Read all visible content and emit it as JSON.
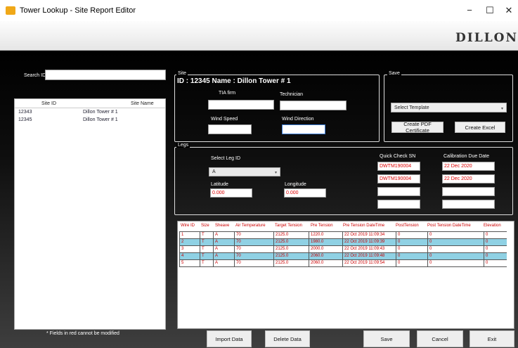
{
  "window": {
    "title": "Tower Lookup - Site Report Editor",
    "minimize": "−",
    "maximize": "☐",
    "close": "✕"
  },
  "logo": "DILLON",
  "search": {
    "label": "Search ID",
    "value": ""
  },
  "site_list": {
    "headers": [
      "Site ID",
      "Site Name"
    ],
    "rows": [
      [
        "12343",
        "Dillon Tower # 1"
      ],
      [
        "12345",
        "Dillon Tower # 1"
      ]
    ]
  },
  "footnote": "* Fields in red cannot be modified",
  "site_group": {
    "title": "Site",
    "heading": "ID : 12345 Name : Dillon Tower # 1",
    "tia_label": "TIA firm",
    "tia_value": "",
    "tech_label": "Technician",
    "tech_value": "",
    "wind_speed_label": "Wind Speed",
    "wind_speed_value": "",
    "wind_dir_label": "Wind Direction",
    "wind_dir_value": ""
  },
  "save_group": {
    "title": "Save",
    "template_value": "Select Template",
    "pdf_button": "Create PDF Certificate",
    "excel_button": "Create Excel"
  },
  "legs_group": {
    "title": "Legs",
    "leg_label": "Select Leg ID",
    "leg_value": "A",
    "lat_label": "Latitude",
    "lat_value": "0.000",
    "lon_label": "Longitude",
    "lon_value": "0.000",
    "qc_label": "Quick Check SN",
    "qc_values": [
      "DWTM190004",
      "DWTM190004",
      "",
      ""
    ],
    "cal_label": "Calibration Due Date",
    "cal_values": [
      "22 Dec 2020",
      "22 Dec 2020",
      "",
      ""
    ]
  },
  "table": {
    "headers": [
      "Wire ID",
      "Size",
      "Sheave",
      "Air Temperature",
      "Target Tension",
      "Pre Tension",
      "Pre Tension DateTime",
      "PostTension",
      "Post Tension DateTime",
      "Elevation"
    ],
    "rows": [
      [
        "1",
        "T",
        "A",
        "70",
        "2125.0",
        "1220.0",
        "22 Oct 2019 11:09:34",
        "0",
        "0",
        "0"
      ],
      [
        "2",
        "T",
        "A",
        "70",
        "2125.0",
        "1980.0",
        "22 Oct 2019 11:09:39",
        "0",
        "0",
        "0"
      ],
      [
        "3",
        "T",
        "A",
        "70",
        "2125.0",
        "2000.0",
        "22 Oct 2019 11:09:43",
        "0",
        "0",
        "0"
      ],
      [
        "4",
        "T",
        "A",
        "70",
        "2125.0",
        "2060.0",
        "22 Oct 2019 11:09:48",
        "0",
        "0",
        "0"
      ],
      [
        "5",
        "T",
        "A",
        "70",
        "2125.0",
        "2060.0",
        "22 Oct 2019 11:09:54",
        "0",
        "0",
        "0"
      ]
    ],
    "selected_rows": [
      2,
      4
    ]
  },
  "buttons": {
    "import": "Import Data",
    "delete": "Delete Data",
    "save": "Save",
    "cancel": "Cancel",
    "exit": "Exit"
  },
  "colors": {
    "accent_selected_row": "#8fd1e4",
    "readonly_text": "#cc0000"
  }
}
